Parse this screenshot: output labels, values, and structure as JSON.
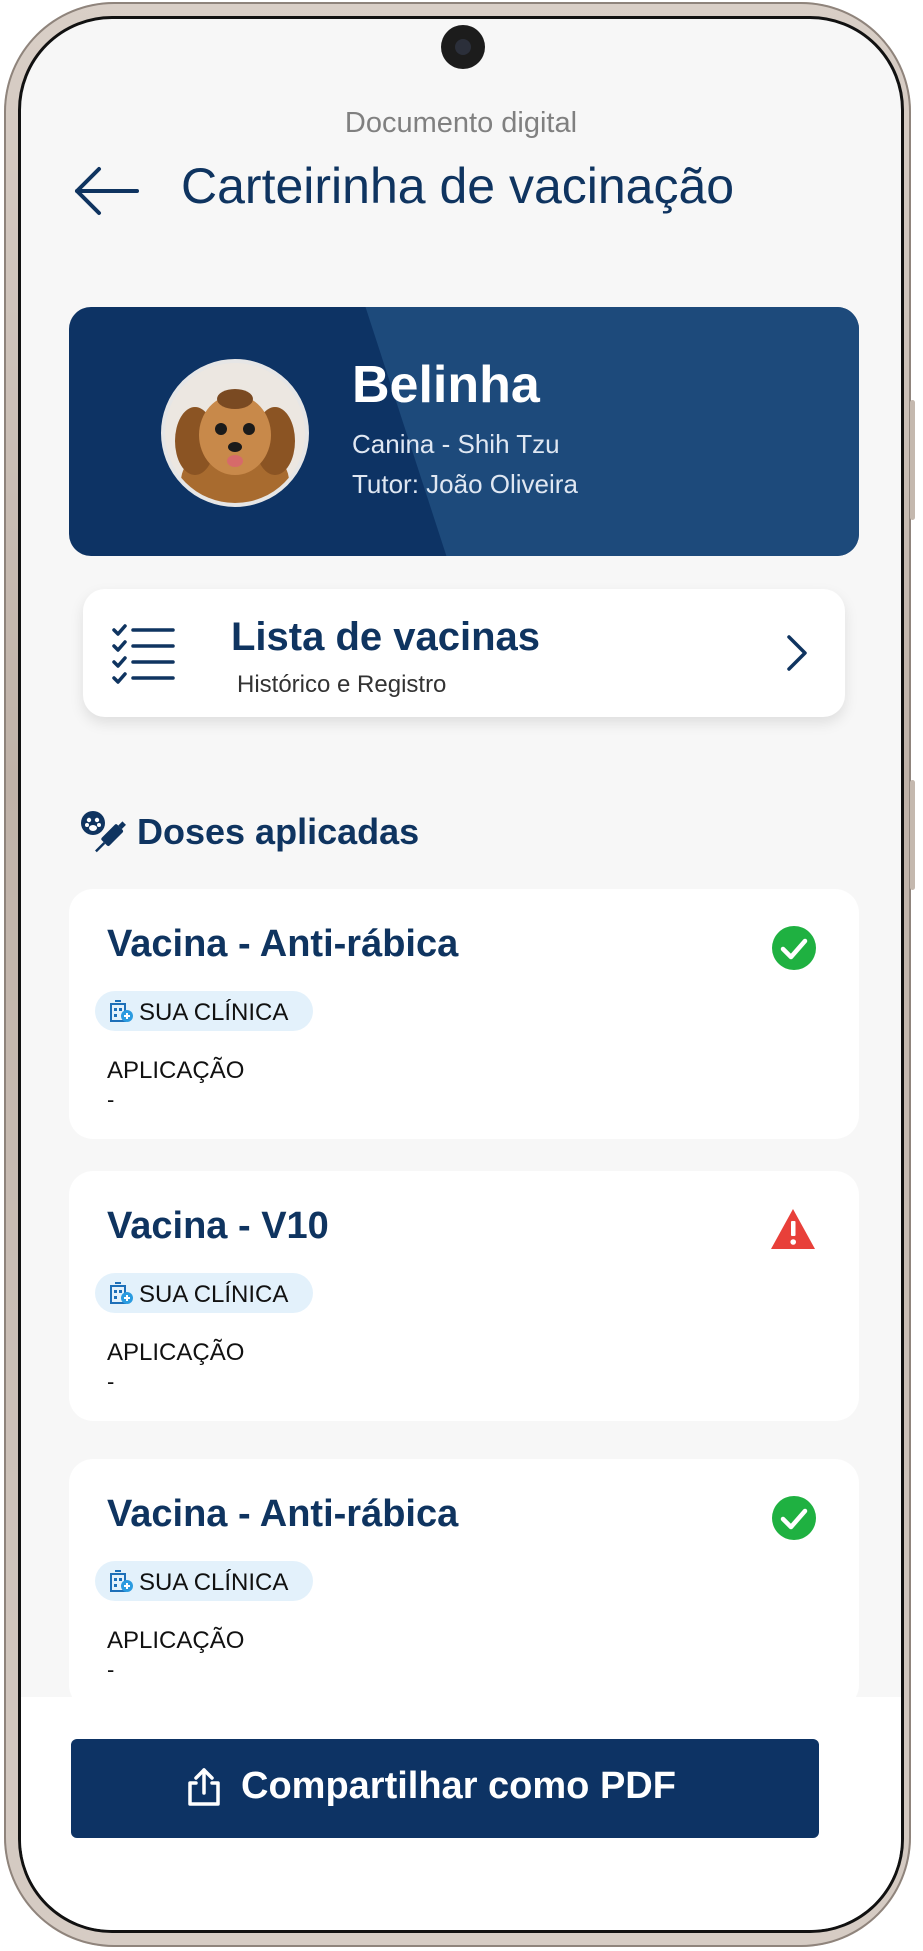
{
  "header": {
    "subtitle": "Documento digital",
    "title": "Carteirinha de vacinação",
    "back_icon": "arrow-left-icon"
  },
  "pet": {
    "name": "Belinha",
    "breed": "Canina -  Shih Tzu",
    "tutor": "Tutor: João Oliveira"
  },
  "vaccine_list_link": {
    "title": "Lista de vacinas",
    "subtitle": "Histórico e Registro",
    "icon": "checklist-icon",
    "chevron": "chevron-right-icon"
  },
  "doses_section": {
    "title": "Doses aplicadas",
    "icon": "paw-syringe-icon"
  },
  "vaccines": [
    {
      "name": "Vacina - Anti-rábica",
      "clinic": "SUA CLÍNICA",
      "application_label": "APLICAÇÃO",
      "application_value": "-",
      "status": "ok",
      "status_icon": "check-circle-icon"
    },
    {
      "name": "Vacina - V10",
      "clinic": "SUA CLÍNICA",
      "application_label": "APLICAÇÃO",
      "application_value": "-",
      "status": "warning",
      "status_icon": "warning-triangle-icon"
    },
    {
      "name": "Vacina - Anti-rábica",
      "clinic": "SUA CLÍNICA",
      "application_label": "APLICAÇÃO",
      "application_value": "-",
      "status": "ok",
      "status_icon": "check-circle-icon"
    }
  ],
  "share_button": {
    "label": "Compartilhar como PDF",
    "icon": "share-upload-icon"
  },
  "colors": {
    "primary_navy": "#0d3364",
    "title_navy": "#0f3460",
    "success_green": "#1fb141",
    "warning_red": "#e8403a",
    "chip_background": "#e3f1fb"
  }
}
